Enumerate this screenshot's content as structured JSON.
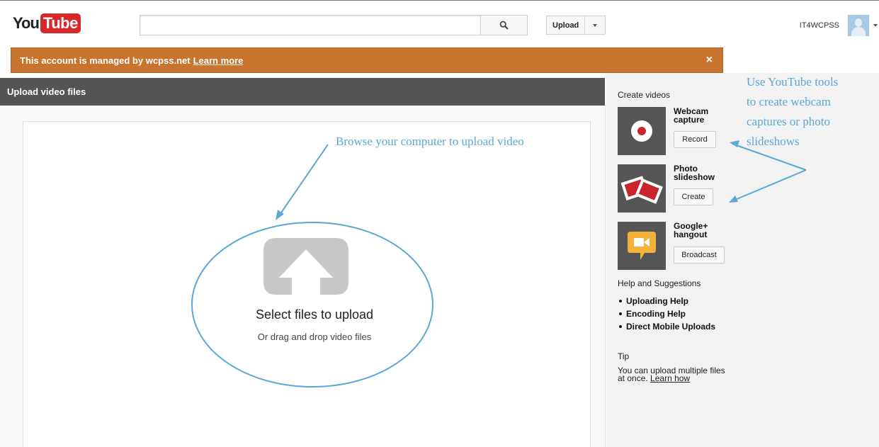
{
  "header": {
    "logo_you": "You",
    "logo_tube": "Tube",
    "search_value": "",
    "upload_label": "Upload",
    "username": "IT4WCPSS"
  },
  "banner": {
    "text": "This account is managed by wcpss.net",
    "link": "Learn more",
    "close": "×"
  },
  "upload": {
    "header": "Upload video files",
    "select_text": "Select files to upload",
    "drag_text": "Or drag and drop video files"
  },
  "sidebar": {
    "create_title": "Create videos",
    "tools": [
      {
        "name_line1": "Webcam",
        "name_line2": "capture",
        "button": "Record",
        "icon": "record-icon"
      },
      {
        "name_line1": "Photo",
        "name_line2": "slideshow",
        "button": "Create",
        "icon": "photo-slideshow-icon"
      },
      {
        "name_line1": "Google+",
        "name_line2": "hangout",
        "button": "Broadcast",
        "icon": "hangout-icon"
      }
    ],
    "help_title": "Help and Suggestions",
    "help_links": [
      "Uploading Help",
      "Encoding Help",
      "Direct Mobile Uploads"
    ],
    "tip_title": "Tip",
    "tip_text": "You can upload multiple files at once.",
    "tip_link": "Learn how"
  },
  "annotations": {
    "browse": "Browse your computer to upload video",
    "tools_line1": "Use YouTube tools",
    "tools_line2": "to create webcam",
    "tools_line3": "captures or photo",
    "tools_line4": "slideshows"
  },
  "colors": {
    "banner": "#c8742f",
    "annotation": "#5ba8d8",
    "logo_red": "#d9262a"
  }
}
